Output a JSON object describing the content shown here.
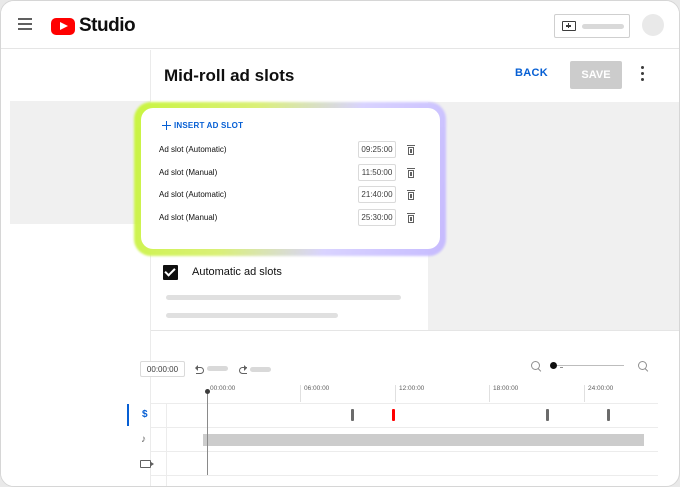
{
  "app": {
    "logo_text": "Studio",
    "brand_color": "#ff0000",
    "accent_color": "#065fd4"
  },
  "header": {
    "title": "Mid-roll ad slots",
    "back_label": "BACK",
    "save_label": "SAVE"
  },
  "ad_slots_panel": {
    "insert_label": "INSERT AD SLOT",
    "slots": [
      {
        "label": "Ad slot (Automatic)",
        "time": "09:25:00"
      },
      {
        "label": "Ad slot (Manual)",
        "time": "11:50:00"
      },
      {
        "label": "Ad slot (Automatic)",
        "time": "21:40:00"
      },
      {
        "label": "Ad slot (Manual)",
        "time": "25:30:00"
      }
    ]
  },
  "automatic": {
    "label": "Automatic ad slots",
    "checked": true
  },
  "timeline": {
    "current_time": "00:00:00",
    "ruler_labels": [
      "00:00:00",
      "06:00:00",
      "12:00:00",
      "18:00:00",
      "24:00:00"
    ],
    "icons": [
      "menu-icon",
      "youtube-logo-icon",
      "create-video-icon",
      "undo-icon",
      "redo-icon",
      "zoom-out-icon",
      "zoom-in-icon",
      "dollar-icon",
      "music-note-icon",
      "video-icon",
      "trash-icon",
      "plus-icon"
    ]
  }
}
